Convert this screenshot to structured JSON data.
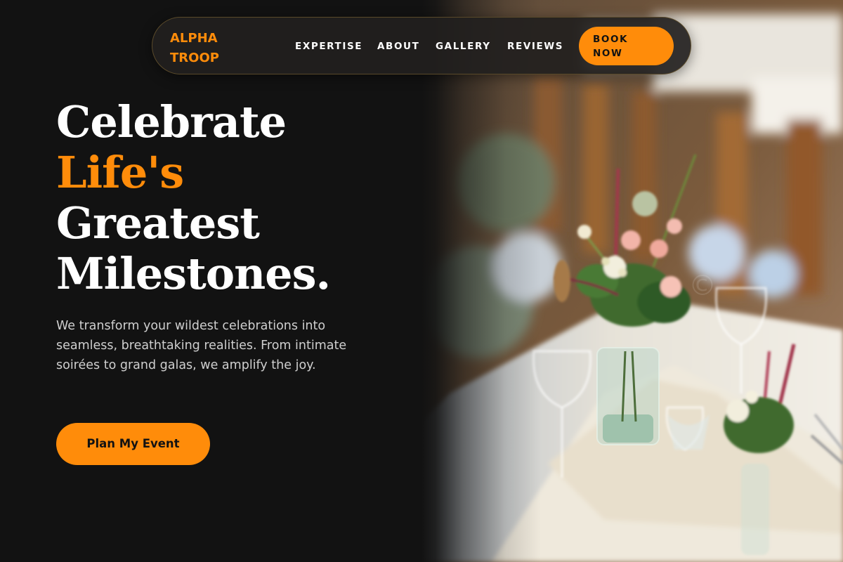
{
  "brand": {
    "logo_line1": "ALPHA",
    "logo_line2": "TROOP",
    "accent_color": "#ff8c0a",
    "background_color": "#121212"
  },
  "nav": {
    "links": [
      "EXPERTISE",
      "ABOUT",
      "GALLERY",
      "REVIEWS"
    ],
    "book_line1": "BOOK",
    "book_line2": "NOW"
  },
  "hero": {
    "headline": [
      "Celebrate",
      "Life's",
      "Greatest",
      "Milestones."
    ],
    "description": "We transform your wildest celebrations into seamless, breathtaking realities. From intimate soirées to grand galas, we amplify the joy.",
    "cta_label": "Plan My Event",
    "image": "banquet-table-flowers-photo"
  }
}
